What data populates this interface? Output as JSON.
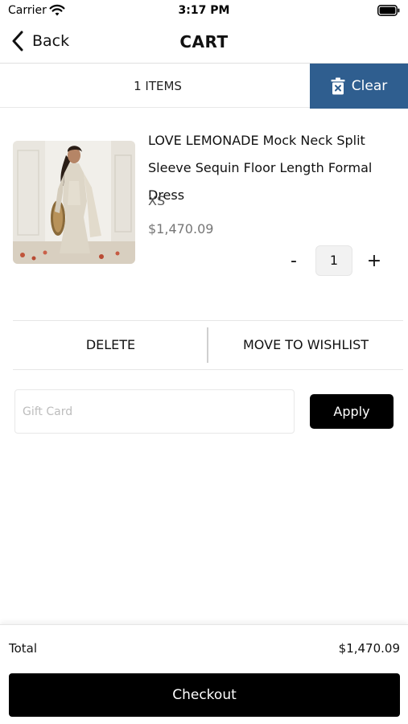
{
  "status_bar": {
    "carrier": "Carrier",
    "time": "3:17 PM",
    "icons": [
      "wifi-icon",
      "battery-icon"
    ]
  },
  "nav": {
    "back_label": "Back",
    "title": "CART",
    "back_icon": "chevron-left-icon"
  },
  "cart_summary": {
    "items_count": "1 ITEMS",
    "clear_label": "Clear",
    "clear_icon": "trash-icon",
    "accent_color": "#2f5e8f"
  },
  "cart_items": [
    {
      "title": "LOVE LEMONADE Mock Neck Split Sleeve Sequin Floor Length Formal Dress",
      "size": "XS",
      "price": "$1,470.09",
      "quantity": "1",
      "minus_label": "-",
      "plus_label": "+",
      "image": "product-photo"
    }
  ],
  "item_actions": {
    "delete_label": "DELETE",
    "wishlist_label": "MOVE TO WISHLIST"
  },
  "gift_card": {
    "placeholder": "Gift Card",
    "value": "",
    "apply_label": "Apply"
  },
  "footer": {
    "total_label": "Total",
    "total_value": "$1,470.09",
    "checkout_label": "Checkout"
  }
}
